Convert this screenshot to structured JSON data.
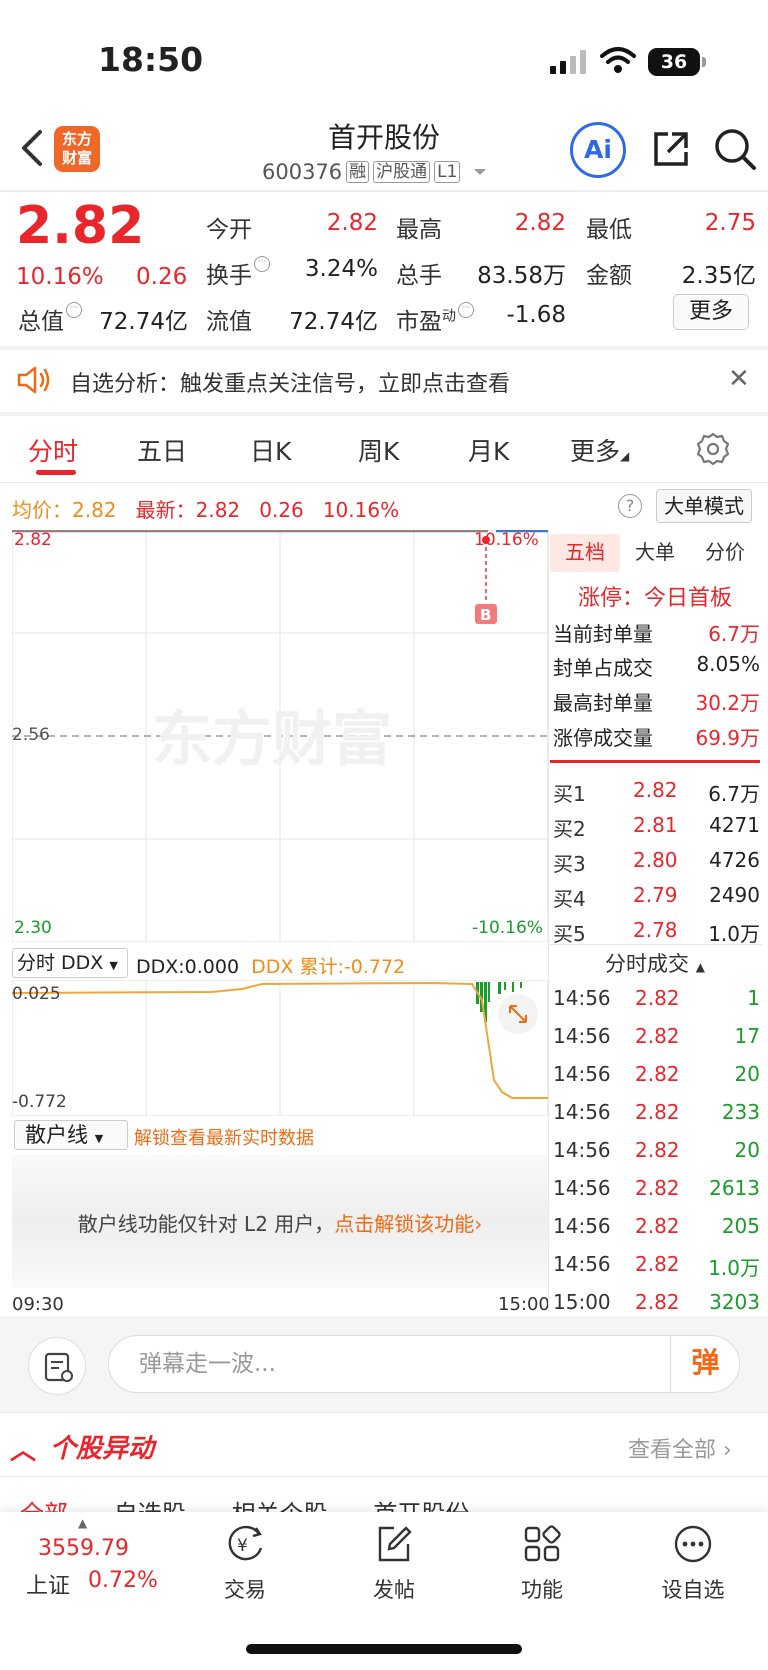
{
  "status": {
    "time": "18:50",
    "battery": "36"
  },
  "header": {
    "logo": "东方\n财富",
    "name": "首开股份",
    "code": "600376",
    "tags": [
      "融",
      "沪股通",
      "L1"
    ],
    "ai": "Ai"
  },
  "quote": {
    "price": "2.82",
    "pct": "10.16%",
    "chg": "0.26",
    "open_label": "今开",
    "open": "2.82",
    "high_label": "最高",
    "high": "2.82",
    "low_label": "最低",
    "low": "2.75",
    "turnover_label": "换手",
    "turnover": "3.24%",
    "volume_label": "总手",
    "volume": "83.58万",
    "amount_label": "金额",
    "amount": "2.35亿",
    "mktcap_label": "总值",
    "mktcap": "72.74亿",
    "float_label": "流值",
    "float": "72.74亿",
    "pe_label": "市盈",
    "pe_sup": "动",
    "pe": "-1.68",
    "more": "更多"
  },
  "alert": {
    "text": "自选分析：触发重点关注信号，立即点击查看"
  },
  "tabs": [
    "分时",
    "五日",
    "日K",
    "周K",
    "月K",
    "更多"
  ],
  "info_line": {
    "avg_label": "均价：",
    "avg": "2.82",
    "latest_label": "最新：",
    "latest": "2.82",
    "chg": "0.26",
    "pct": "10.16%",
    "big_order_mode": "大单模式"
  },
  "chart": {
    "y_top": "2.82",
    "y_mid": "2.56",
    "y_bot": "2.30",
    "pct_top": "10.16%",
    "pct_bot": "-10.16%",
    "marker": "B",
    "watermark": "东方财富",
    "ddx_select": "分时 DDX",
    "ddx_value": "DDX:0.000",
    "ddx_cum": "DDX 累计:-0.772",
    "ddx_top": "0.025",
    "ddx_bot": "-0.772",
    "retail_select": "散户线",
    "retail_unlock": "解锁查看最新实时数据",
    "retail_msg": "散户线功能仅针对 L2 用户，",
    "retail_link": "点击解锁该功能",
    "time_start": "09:30",
    "time_end": "15:00"
  },
  "orderbook": {
    "tabs": [
      "五档",
      "大单",
      "分价"
    ],
    "limit_up": "涨停：今日首板",
    "stats": [
      {
        "label": "当前封单量",
        "value": "6.7万"
      },
      {
        "label": "封单占成交",
        "value": "8.05%"
      },
      {
        "label": "最高封单量",
        "value": "30.2万"
      },
      {
        "label": "涨停成交量",
        "value": "69.9万"
      }
    ],
    "bids": [
      {
        "label": "买1",
        "price": "2.82",
        "qty": "6.7万"
      },
      {
        "label": "买2",
        "price": "2.81",
        "qty": "4271"
      },
      {
        "label": "买3",
        "price": "2.80",
        "qty": "4726"
      },
      {
        "label": "买4",
        "price": "2.79",
        "qty": "2490"
      },
      {
        "label": "买5",
        "price": "2.78",
        "qty": "1.0万"
      }
    ],
    "trades_header": "分时成交",
    "trades": [
      {
        "time": "14:56",
        "price": "2.82",
        "qty": "1"
      },
      {
        "time": "14:56",
        "price": "2.82",
        "qty": "17"
      },
      {
        "time": "14:56",
        "price": "2.82",
        "qty": "20"
      },
      {
        "time": "14:56",
        "price": "2.82",
        "qty": "233"
      },
      {
        "time": "14:56",
        "price": "2.82",
        "qty": "20"
      },
      {
        "time": "14:56",
        "price": "2.82",
        "qty": "2613"
      },
      {
        "time": "14:56",
        "price": "2.82",
        "qty": "205"
      },
      {
        "time": "14:56",
        "price": "2.82",
        "qty": "1.0万"
      },
      {
        "time": "15:00",
        "price": "2.82",
        "qty": "3203"
      }
    ]
  },
  "comment": {
    "placeholder": "弹幕走一波...",
    "button": "弹"
  },
  "movers": {
    "title": "个股异动",
    "all": "查看全部",
    "tabs": [
      "全部",
      "自选股",
      "相关个股",
      "首开股份"
    ]
  },
  "bottom_nav": {
    "index_value": "3559.79",
    "index_name": "上证",
    "index_pct": "0.72%",
    "items": [
      "交易",
      "发帖",
      "功能",
      "设自选"
    ]
  },
  "colors": {
    "red": "#e8262c",
    "green": "#1a9b2b",
    "orange": "#f08c1a",
    "blue": "#2d6be6"
  }
}
